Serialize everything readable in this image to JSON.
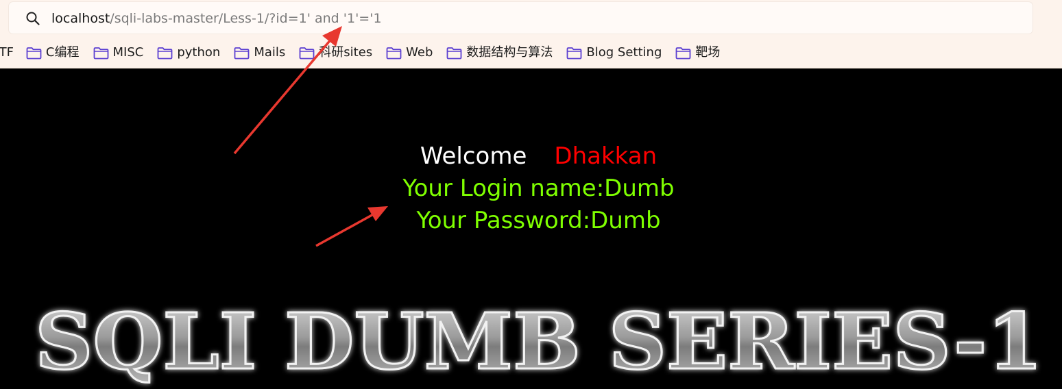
{
  "address_bar": {
    "url_host": "localhost",
    "url_path": "/sqli-labs-master/Less-1/?id=1' and '1'='1"
  },
  "bookmarks": [
    {
      "label": "CTF"
    },
    {
      "label": "C编程"
    },
    {
      "label": "MISC"
    },
    {
      "label": "python"
    },
    {
      "label": "Mails"
    },
    {
      "label": "科研sites"
    },
    {
      "label": "Web"
    },
    {
      "label": "数据结构与算法"
    },
    {
      "label": "Blog Setting"
    },
    {
      "label": "靶场"
    }
  ],
  "page": {
    "welcome": "Welcome",
    "user_name": "Dhakkan",
    "login_name": "Your Login name:Dumb",
    "password": "Your Password:Dumb",
    "banner": "SQLI DUMB SERIES-1"
  },
  "colors": {
    "welcome": "#ffffff",
    "user_name": "#ff0000",
    "info_text": "#7fff00",
    "arrow": "#e8382f",
    "folder_icon": "#5b3fd1"
  },
  "icons": {
    "search": "search-icon",
    "folder": "folder-icon"
  }
}
